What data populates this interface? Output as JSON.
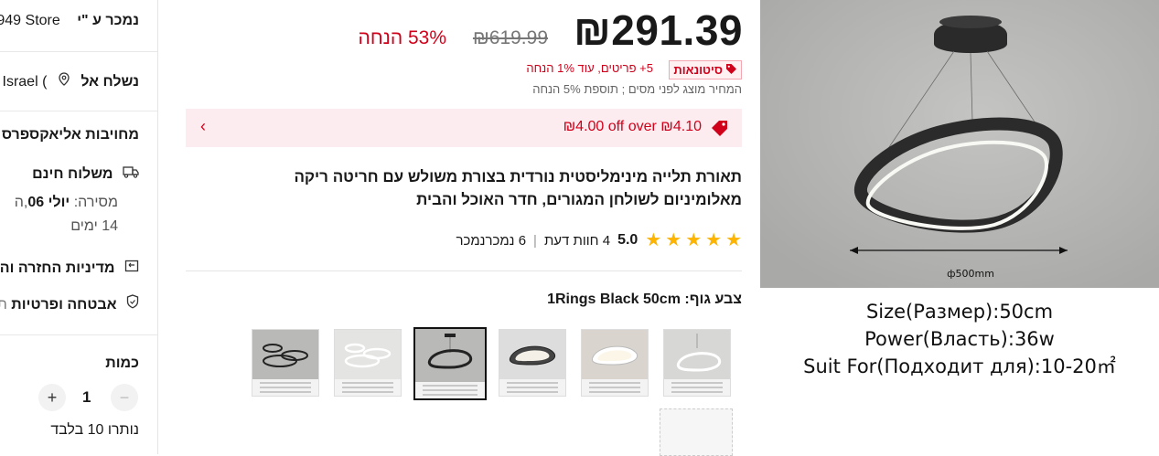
{
  "sidebar": {
    "sold_by_label": "נמכר ע \"י",
    "store_name": "949 Store",
    "ship_to_label": "נשלח אל",
    "ship_to_value": "Israel (",
    "commitment": "מחויבות אליאקספרס",
    "free_shipping": "משלוח חינם",
    "delivery_label": "מסירה:",
    "delivery_date": "יולי 06",
    "delivery_tail": ",ה",
    "delivery_days": "14 ימים",
    "return_policy": "מדיניות החזרה וה",
    "security": "אבטחה ופרטיות",
    "security_tail": "ת",
    "quantity_label": "כמות",
    "quantity_value": "1",
    "minus": "−",
    "plus": "+",
    "stock_left": "נותרו 10 בלבד"
  },
  "price": {
    "current": "₪291.39",
    "original": "₪619.99",
    "discount": "53% הנחה",
    "wholesale_badge": "סיטונאות",
    "wholesale_text": "5+ פריטים, עוד 1% הנחה",
    "tax_note": "המחיר מוצג לפני מסים ; תוספת 5% הנחה"
  },
  "coupon": {
    "text": "₪4.00 off over ₪4.10",
    "chevron": "‹"
  },
  "product": {
    "title": "תאורת תלייה מינימליסטית נורדית בצורת משולש עם חריטה ריקה מאלומיניום לשולחן המגורים, חדר האוכל והבית",
    "rating": "5.0",
    "reviews": "4 חוות דעת",
    "sold": "6 נמכרנמכר",
    "rating_sep": "|",
    "stars": 5,
    "color_label": "צבע גוף: 1Rings Black 50cm"
  },
  "image": {
    "dimension_label": "ф500mm",
    "specs": [
      "Size(Размер):50cm",
      "Power(Власть):36w",
      "Suit For(Подходит для):10-20㎡"
    ]
  },
  "colors": {
    "accent": "#d0021b",
    "star": "#fdb400",
    "coupon_bg": "#fdecef"
  },
  "icons": [
    "location-pin-icon",
    "truck-icon",
    "return-box-icon",
    "shield-icon",
    "tag-icon",
    "wholesale-tag-icon",
    "chevron-left-icon",
    "star-icon"
  ]
}
